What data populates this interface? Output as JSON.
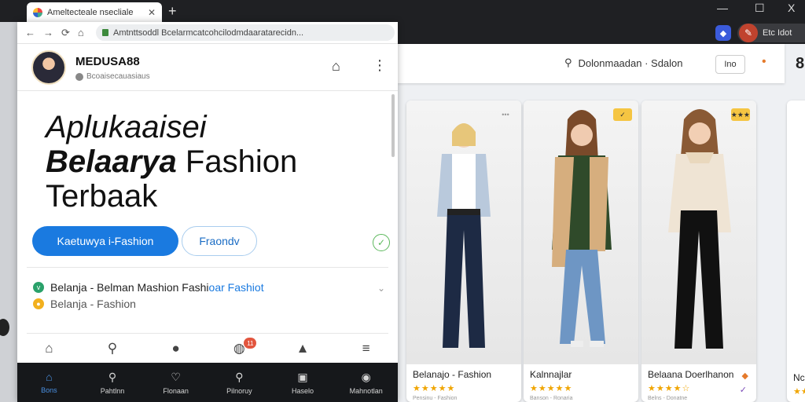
{
  "browser": {
    "tab_title": "Ameltecteale nsecliale",
    "tab_close": "✕",
    "new_tab": "+",
    "window_controls": {
      "minimize": "—",
      "maximize": "☐",
      "close": "X"
    },
    "url": "Amtnttsoddl Bcelarmcatcohcilodmdaaratarecidn...",
    "nav_back": "←",
    "nav_forward": "→",
    "nav_reload": "⟳",
    "nav_home": "⌂",
    "ext_label": "Etc Idot"
  },
  "app": {
    "brand": "MEDUSA88",
    "brand_sub": "Bcoaisecauasiaus",
    "hero": {
      "line1": "Aplukaaisei",
      "line2_bold": "Belaarya",
      "line2_rest": "Fashion",
      "line3": "Terbaak"
    },
    "primary_button": "Kaetuwya i-Fashion",
    "secondary_button": "Fraondv",
    "list": [
      {
        "text": "Belanja - Belman Mashion Fashi",
        "link": "oar Fashiot"
      },
      {
        "text": "Belanja - Fashion"
      }
    ],
    "nav_top_badge": "11",
    "nav_bottom": [
      "Bons",
      "Pahtlnn",
      "Flonaan",
      "Pilnoruy",
      "Haselo",
      "Mahnotlan"
    ]
  },
  "background": {
    "search_text": "Dolonmaadan · Sdalon",
    "header_button": "Ino",
    "right_glyph": "8",
    "products": [
      {
        "title": "Belanajo - Fashion",
        "stars": "★★★★★",
        "meta": "Pensinu - Fashion",
        "badge": "•••"
      },
      {
        "title": "Kalnnajlar",
        "stars": "★★★★★",
        "meta": "Banson - Ronaria",
        "badge": "✓"
      },
      {
        "title": "Belaana Doerlhanon",
        "stars": "★★★★☆",
        "meta": "Belns - Donatne",
        "badge": "★★★"
      }
    ],
    "edge_title": "Nc",
    "edge_stars": "★★"
  },
  "colors": {
    "primary": "#1a7ae0",
    "dark": "#16181b",
    "star": "#f0a500"
  }
}
